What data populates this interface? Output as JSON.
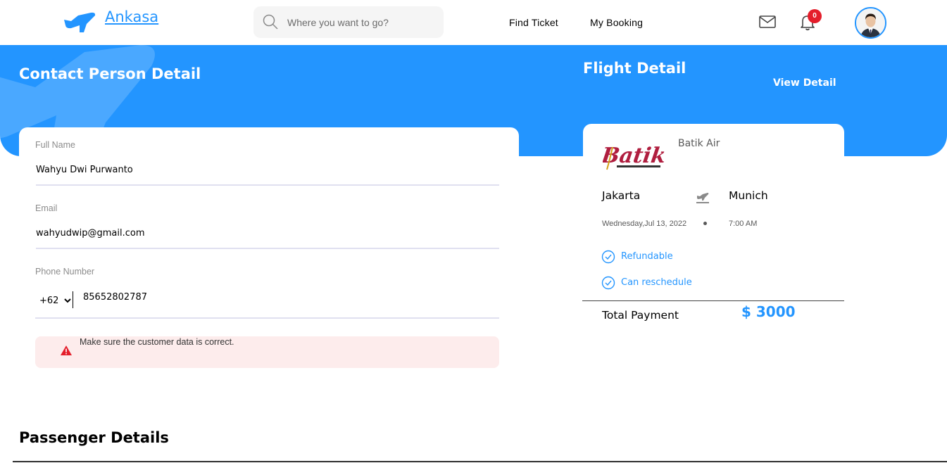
{
  "nav": {
    "brand": "Ankasa",
    "search_placeholder": "Where you want to go?",
    "links": [
      {
        "label": "Find Ticket"
      },
      {
        "label": "My Booking"
      }
    ],
    "notification_count": "0"
  },
  "contact": {
    "title": "Contact Person Detail",
    "full_name_label": "Full Name",
    "full_name_value": "Wahyu Dwi Purwanto",
    "email_label": "Email",
    "email_value": "wahyudwip@gmail.com",
    "phone_label": "Phone Number",
    "phone_code": "+62",
    "phone_value": "85652802787",
    "warning": "Make sure the customer data is correct."
  },
  "flight": {
    "title": "Flight Detail",
    "view_detail": "View Detail",
    "airline": "Batik Air",
    "from_city": "Jakarta",
    "to_city": "Munich",
    "date": "Wednesday,Jul 13, 2022",
    "time": "7:00 AM",
    "features": [
      "Refundable",
      "Can reschedule"
    ],
    "total_label": "Total Payment",
    "total_value": "$ 3000"
  },
  "passenger": {
    "title": "Passenger Details"
  },
  "colors": {
    "primary": "#2395FF",
    "warning_bg": "#FDECEC",
    "badge": "#E41E2B"
  }
}
